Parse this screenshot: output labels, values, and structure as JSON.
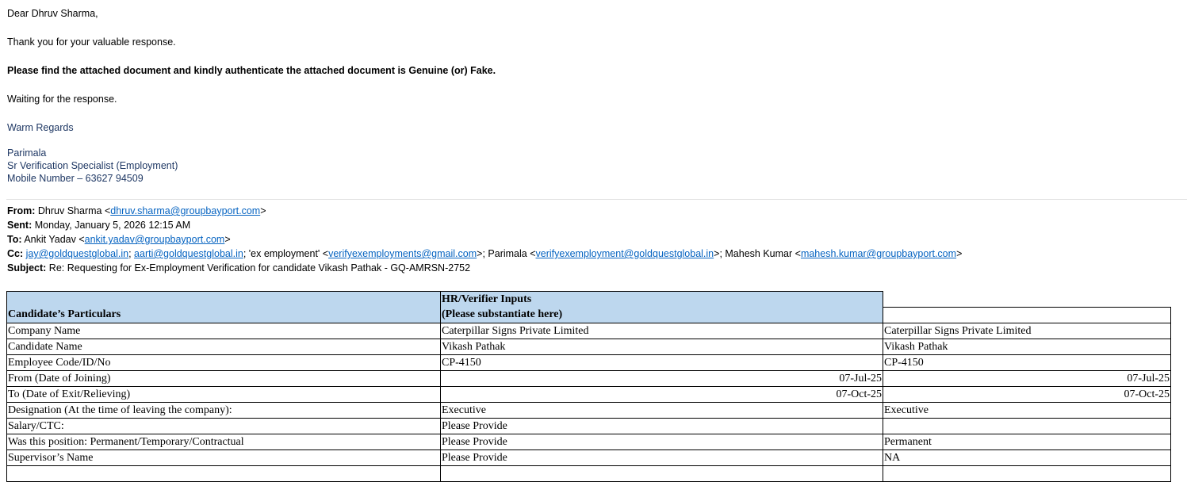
{
  "body": {
    "greeting": "Dear Dhruv Sharma,",
    "thanks": "Thank you for your valuable response.",
    "request": "Please find the attached document and kindly authenticate the attached document is Genuine (or) Fake.",
    "waiting": "Waiting for the response.",
    "regards": "Warm Regards",
    "sig_name": "Parimala",
    "sig_title": "Sr Verification Specialist (Employment)",
    "sig_mobile": "Mobile Number – 63627 94509"
  },
  "header": {
    "from_label": "From:",
    "from_name": "Dhruv Sharma <",
    "from_email": "dhruv.sharma@groupbayport.com",
    "sent_label": "Sent:",
    "sent": "Monday, January 5, 2026 12:15 AM",
    "to_label": "To:",
    "to_name": "Ankit Yadav <",
    "to_email": "ankit.yadav@groupbayport.com",
    "cc_label": "Cc:",
    "cc1": "jay@goldquestglobal.in",
    "cc2": "aarti@goldquestglobal.in",
    "cc3_name": "'ex employment' <",
    "cc3": "verifyexemployments@gmail.com",
    "cc4_name": "Parimala <",
    "cc4": "verifyexemployment@goldquestglobal.in",
    "cc5_name": "Mahesh Kumar <",
    "cc5": "mahesh.kumar@groupbayport.com",
    "subject_label": "Subject:",
    "subject": "Re: Requesting for Ex-Employment Verification for candidate Vikash Pathak - GQ-AMRSN-2752"
  },
  "table": {
    "h_col1": "Candidate’s Particulars",
    "h_col2_line1": "HR/Verifier Inputs",
    "h_col2_line2": "(Please substantiate here)",
    "rows": [
      {
        "label": "Company Name",
        "hr": "Caterpillar Signs Private Limited",
        "val": "Caterpillar Signs Private Limited"
      },
      {
        "label": "Candidate Name",
        "hr": "Vikash Pathak",
        "val": "Vikash Pathak"
      },
      {
        "label": "Employee Code/ID/No",
        "hr": "CP-4150",
        "val": "CP-4150"
      },
      {
        "label": "From (Date of Joining)",
        "hr": "07-Jul-25",
        "val": "07-Jul-25"
      },
      {
        "label": "To (Date of Exit/Relieving)",
        "hr": "07-Oct-25",
        "val": "07-Oct-25"
      },
      {
        "label": "Designation (At the time of leaving the company):",
        "hr": "Executive",
        "val": "Executive"
      },
      {
        "label": "Salary/CTC:",
        "hr": "Please Provide",
        "val": ""
      },
      {
        "label": "Was this position: Permanent/Temporary/Contractual",
        "hr": "Please Provide",
        "val": "Permanent"
      },
      {
        "label": "Supervisor’s Name",
        "hr": "Please Provide",
        "val": "NA"
      }
    ]
  }
}
